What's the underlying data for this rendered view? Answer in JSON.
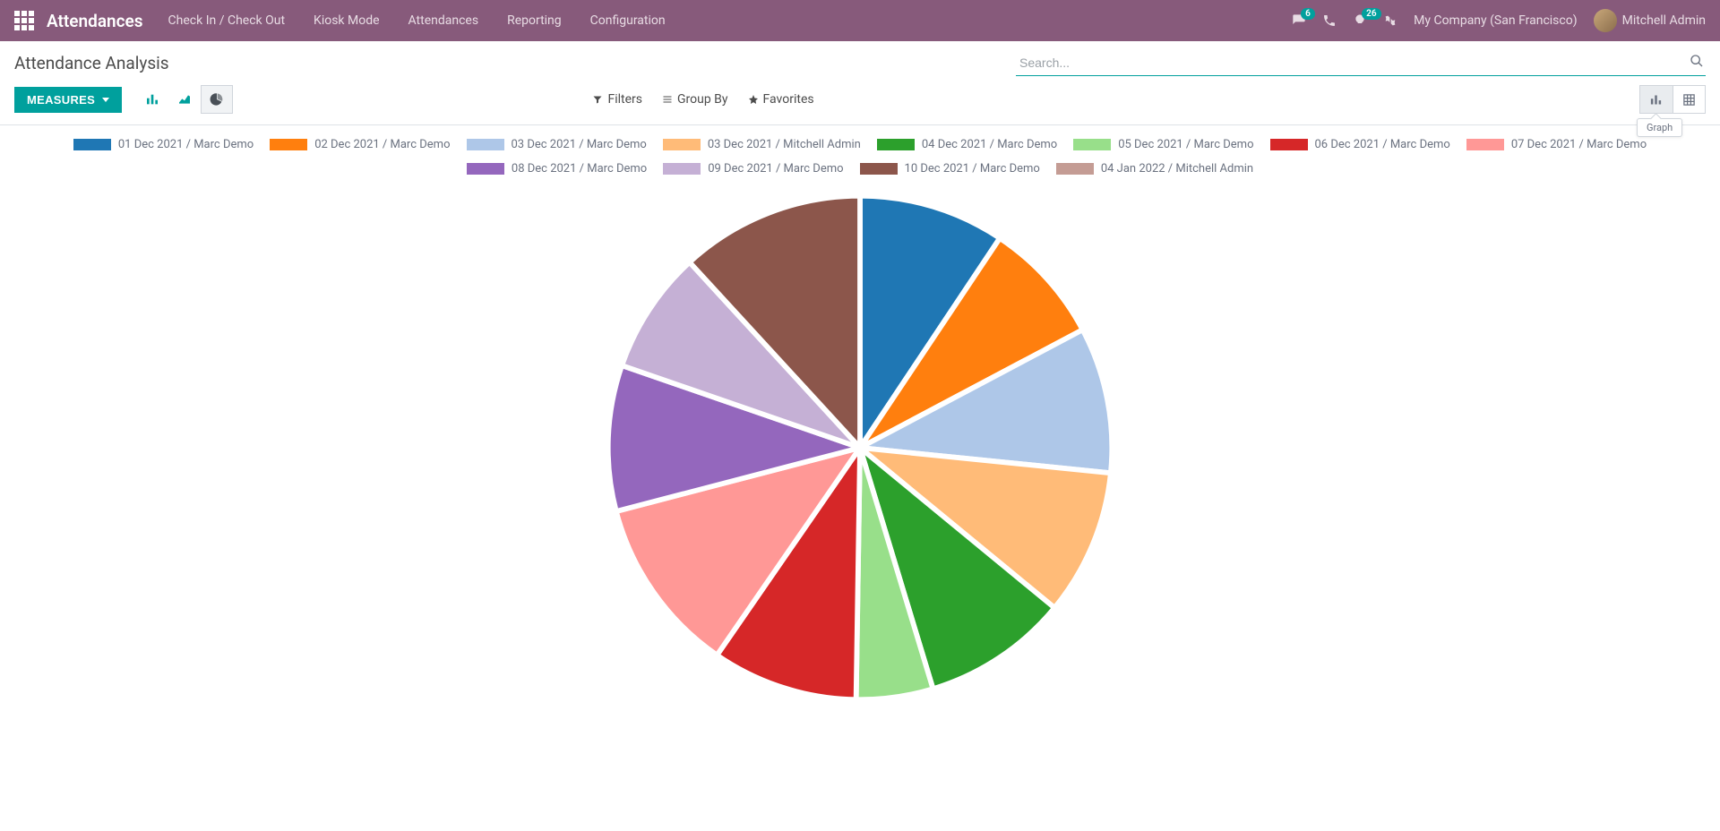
{
  "topbar": {
    "brand": "Attendances",
    "menu": [
      "Check In / Check Out",
      "Kiosk Mode",
      "Attendances",
      "Reporting",
      "Configuration"
    ],
    "msg_badge": "6",
    "act_badge": "26",
    "company": "My Company (San Francisco)",
    "user": "Mitchell Admin"
  },
  "control": {
    "title": "Attendance Analysis",
    "search_placeholder": "Search..."
  },
  "toolbar": {
    "measures_label": "MEASURES",
    "filters": "Filters",
    "groupby": "Group By",
    "favorites": "Favorites",
    "tooltip": "Graph"
  },
  "chart_data": {
    "type": "pie",
    "title": "Attendance Analysis",
    "series": [
      {
        "name": "01 Dec 2021 / Marc Demo",
        "value": 9.5,
        "color": "#1f77b4"
      },
      {
        "name": "02 Dec 2021 / Marc Demo",
        "value": 8.0,
        "color": "#ff7f0e"
      },
      {
        "name": "03 Dec 2021 / Marc Demo",
        "value": 9.5,
        "color": "#aec7e8"
      },
      {
        "name": "03 Dec 2021 / Mitchell Admin",
        "value": 9.5,
        "color": "#ffbb78"
      },
      {
        "name": "04 Dec 2021 / Marc Demo",
        "value": 9.5,
        "color": "#2ca02c"
      },
      {
        "name": "05 Dec 2021 / Marc Demo",
        "value": 5.0,
        "color": "#98df8a"
      },
      {
        "name": "06 Dec 2021 / Marc Demo",
        "value": 9.5,
        "color": "#d62728"
      },
      {
        "name": "07 Dec 2021 / Marc Demo",
        "value": 11.5,
        "color": "#ff9896"
      },
      {
        "name": "08 Dec 2021 / Marc Demo",
        "value": 9.5,
        "color": "#9467bd"
      },
      {
        "name": "09 Dec 2021 / Marc Demo",
        "value": 8.0,
        "color": "#c5b0d5"
      },
      {
        "name": "10 Dec 2021 / Marc Demo",
        "value": 12.0,
        "color": "#8c564b"
      },
      {
        "name": "04 Jan 2022 / Mitchell Admin",
        "value": 0.0,
        "color": "#c49c94"
      }
    ]
  }
}
